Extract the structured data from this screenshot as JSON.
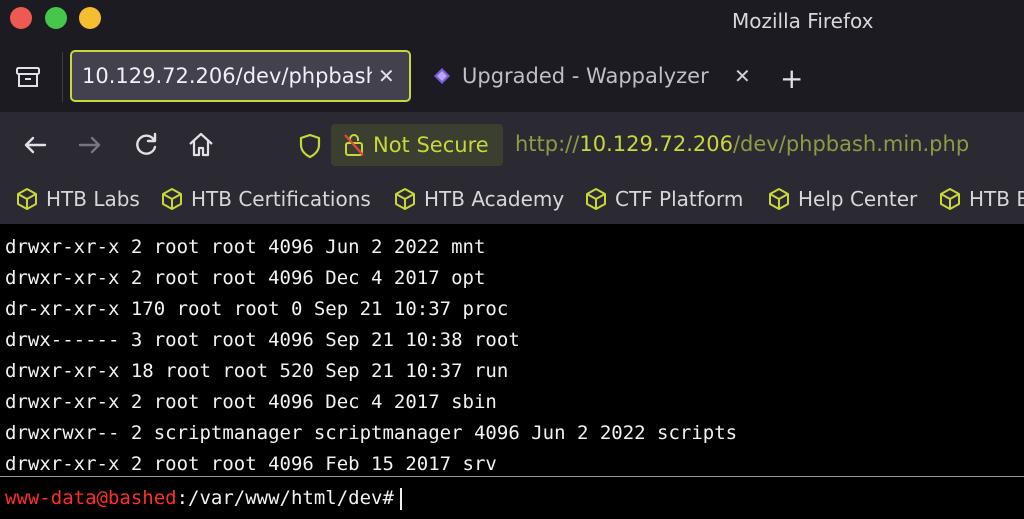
{
  "window": {
    "title": "Mozilla Firefox"
  },
  "tabs": [
    {
      "label": "10.129.72.206/dev/phpbash.min.php",
      "active": true
    },
    {
      "label": "Upgraded - Wappalyzer",
      "active": false
    }
  ],
  "tab_close_glyph": "✕",
  "new_tab_glyph": "+",
  "navbar": {
    "security_label": "Not Secure",
    "url_scheme": "http://",
    "url_host": "10.129.72.206",
    "url_path": "/dev/phpbash.min.php"
  },
  "bookmarks": [
    {
      "label": "HTB Labs"
    },
    {
      "label": "HTB Certifications"
    },
    {
      "label": "HTB Academy"
    },
    {
      "label": "CTF Platform"
    },
    {
      "label": "Help Center"
    },
    {
      "label": "HTB B"
    }
  ],
  "terminal": {
    "lines": [
      "drwxr-xr-x 2 root root 4096 Jun 2 2022 mnt",
      "drwxr-xr-x 2 root root 4096 Dec 4 2017 opt",
      "dr-xr-xr-x 170 root root 0 Sep 21 10:37 proc",
      "drwx------ 3 root root 4096 Sep 21 10:38 root",
      "drwxr-xr-x 18 root root 520 Sep 21 10:37 run",
      "drwxr-xr-x 2 root root 4096 Dec 4 2017 sbin",
      "drwxrwxr-- 2 scriptmanager scriptmanager 4096 Jun 2 2022 scripts",
      "drwxr-xr-x 2 root root 4096 Feb 15 2017 srv"
    ],
    "prompt_user": "www-data@bashed",
    "prompt_path": ":/var/www/html/dev#"
  },
  "colors": {
    "accent": "#c8d83a",
    "prompt_user": "#ff2d2d"
  },
  "icons": {
    "tab_list": "tab-list-icon",
    "back": "back-arrow-icon",
    "forward": "forward-arrow-icon",
    "reload": "reload-icon",
    "home": "home-icon",
    "tracking": "shield-icon",
    "insecure": "broken-lock-icon",
    "bookmark": "cube-icon",
    "wappalyzer": "wappalyzer-icon"
  }
}
